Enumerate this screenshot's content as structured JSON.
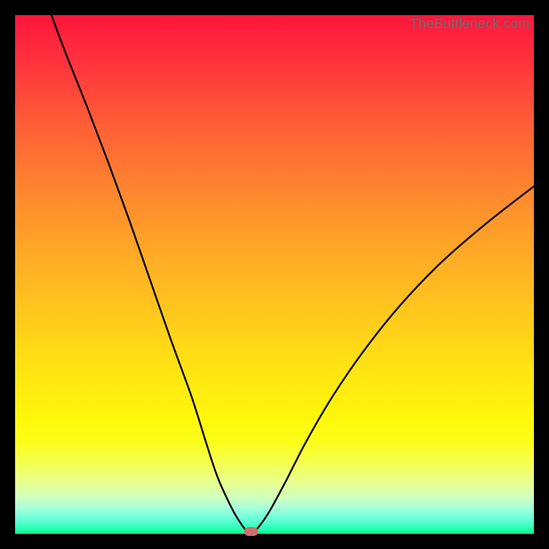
{
  "watermark": "TheBottleneck.com",
  "marker": {
    "cx_frac": 0.455,
    "cy_frac": 0.995
  },
  "chart_data": {
    "type": "line",
    "title": "",
    "xlabel": "",
    "ylabel": "",
    "xlim": [
      0,
      100
    ],
    "ylim": [
      0,
      100
    ],
    "x": [
      7,
      10,
      14,
      18,
      22,
      26,
      30,
      34,
      37,
      39,
      41,
      42.5,
      43.8,
      44.6,
      45,
      45.5,
      46,
      47,
      49,
      52,
      56,
      61,
      67,
      74,
      82,
      91,
      100
    ],
    "values": [
      100,
      92,
      82,
      71.5,
      60.5,
      49,
      37.5,
      26.5,
      17,
      11,
      6.5,
      3.6,
      1.6,
      0.55,
      0.1,
      0.1,
      0.4,
      1.4,
      4.3,
      9.8,
      17.6,
      26.2,
      35,
      43.8,
      52.2,
      60,
      67
    ],
    "note": "Values are read off the plot as percent of full axis range; no tick labels present."
  }
}
